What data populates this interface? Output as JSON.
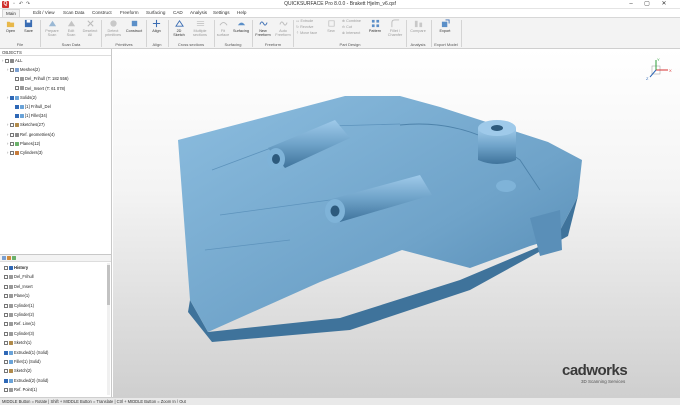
{
  "app": {
    "title": "QUICKSURFACE Pro 8.0.0 - Brakett Hjelm_v6.qsf"
  },
  "menu": {
    "tabs": [
      "Main",
      "Edit / View",
      "Scan Data",
      "Construct",
      "Freeform",
      "Surfacing",
      "CAD",
      "Analysis",
      "Settings",
      "Help"
    ],
    "active": "Main"
  },
  "ribbon": {
    "file": {
      "open": "Open",
      "save": "Save",
      "group": "File"
    },
    "scan_data": {
      "prepare": "Prepare\nScan",
      "edit": "Edit\nScan",
      "deselect": "Deselect\nAll",
      "group": "Scan Data"
    },
    "primitives": {
      "detect": "Detect\nprimitives",
      "construct": "Construct",
      "group": "Primitives"
    },
    "align": {
      "align": "Align",
      "group": "Align"
    },
    "cross_sections": {
      "sketch": "2D\nSketch",
      "multiple": "Multiple\nsections",
      "group": "Cross sections"
    },
    "surfacing": {
      "fit": "Fit\nsurface",
      "surfacing": "Surfacing",
      "group": "Surfacing"
    },
    "freeform": {
      "new": "New\nFreeform",
      "auto": "Auto\nFreeform",
      "group": "Freeform"
    },
    "part_design": {
      "extrude": "Extrude",
      "revolve": "Revolve",
      "move_face": "Move face",
      "sew": "Sew",
      "combine": "Combine",
      "cut": "Cut",
      "intersect": "Intersect",
      "pattern": "Pattern",
      "fillet": "Fillet /\nChamfer",
      "group": "Part Design"
    },
    "analysis": {
      "compare": "Compare",
      "group": "Analysis"
    },
    "export": {
      "export": "Export",
      "group": "Export Model"
    }
  },
  "objects_panel": {
    "header": "OBJECTS",
    "rows": [
      {
        "label": "ALL",
        "checked": false,
        "indent": 0
      },
      {
        "label": "Meshes(2)",
        "checked": false,
        "indent": 1
      },
      {
        "label": "Del_Frihull (T: 182 556)",
        "checked": false,
        "indent": 2
      },
      {
        "label": "Del_Insert (T: 61 078)",
        "checked": false,
        "indent": 2
      },
      {
        "label": "Solids(2)",
        "checked": true,
        "indent": 1
      },
      {
        "label": "[1] Frihull_Del",
        "checked": true,
        "indent": 2
      },
      {
        "label": "[1] Fillet(34)",
        "checked": true,
        "indent": 2
      },
      {
        "label": "Sketches(27)",
        "checked": false,
        "indent": 1
      },
      {
        "label": "Ref. geometries(4)",
        "checked": false,
        "indent": 1
      },
      {
        "label": "Planes(12)",
        "checked": false,
        "indent": 1
      },
      {
        "label": "Cylinders(3)",
        "checked": false,
        "indent": 1
      }
    ]
  },
  "history_panel": {
    "rows": [
      {
        "label": "History",
        "checked": false
      },
      {
        "label": "Del_Frihull",
        "checked": false
      },
      {
        "label": "Del_Insert",
        "checked": false
      },
      {
        "label": "Plane(1)",
        "checked": false
      },
      {
        "label": "Cylinder(1)",
        "checked": false
      },
      {
        "label": "Cylinder(2)",
        "checked": false
      },
      {
        "label": "Ref. Line(1)",
        "checked": false
      },
      {
        "label": "Cylinder(3)",
        "checked": false
      },
      {
        "label": "Sketch(1)",
        "checked": false
      },
      {
        "label": "Extruded(1) (Solid)",
        "checked": true
      },
      {
        "label": "Fillet(1) (Solid)",
        "checked": false
      },
      {
        "label": "Sketch(2)",
        "checked": false
      },
      {
        "label": "Extruded(2) (Solid)",
        "checked": true
      },
      {
        "label": "Ref. Point(1)",
        "checked": false
      }
    ]
  },
  "viewport": {
    "brand": "cadworks",
    "brand_sub": "3D Scanning Services",
    "model_color": "#6fa3c9",
    "axis": {
      "x": "X",
      "y": "Y",
      "z": "Z"
    }
  },
  "statusbar": {
    "text": "MIDDLE Button = Rotate | Shift + MIDDLE Button = Translate | Ctrl + MIDDLE Button = Zoom In / Out"
  },
  "colors": {
    "accent": "#2f68b6",
    "brand_red": "#d0312d",
    "ribbon_bg": "#f3f3f3"
  },
  "icons": [
    "app-logo-icon",
    "open-icon",
    "save-icon",
    "undo-icon",
    "redo-icon",
    "axis-triad-icon"
  ]
}
